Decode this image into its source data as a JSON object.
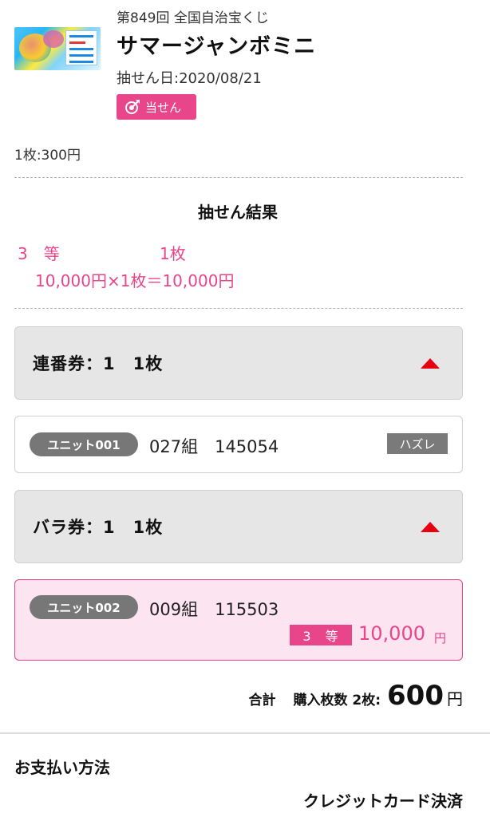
{
  "header": {
    "lottery_number": "第849回 全国自治宝くじ",
    "lottery_name": "サマージャンボミニ",
    "draw_date": "抽せん日:2020/08/21",
    "status_badge": "当せん"
  },
  "unit_price": "1枚:300円",
  "result": {
    "title": "抽せん結果",
    "rank": "3　等",
    "count": "1枚",
    "calculation": "10,000円×1枚＝10,000円"
  },
  "sections": [
    {
      "label": "連番券：1　1枚",
      "tickets": [
        {
          "unit": "ユニット001",
          "number": "027組　145054",
          "status": "ハズレ"
        }
      ]
    },
    {
      "label": "バラ券：1　1枚",
      "tickets": [
        {
          "unit": "ユニット002",
          "number": "009組　115503",
          "rank": "3　等",
          "prize": "10,000",
          "prize_unit": "円"
        }
      ]
    }
  ],
  "total": {
    "label": "合計",
    "count_label": "購入枚数 2枚:",
    "amount": "600",
    "unit": "円"
  },
  "payment": {
    "title": "お支払い方法",
    "method": "クレジットカード決済"
  },
  "colors": {
    "accent_pink": "#e8458b",
    "win_background": "#fde4f1",
    "triangle_red": "#e60012"
  }
}
